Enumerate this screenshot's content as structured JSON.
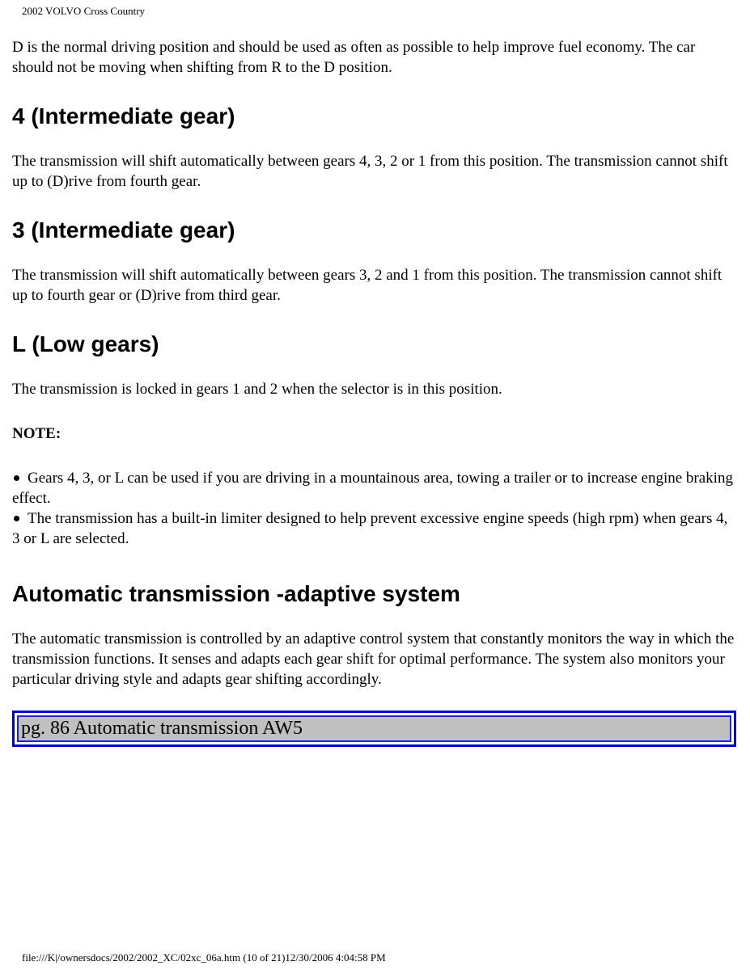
{
  "header": {
    "title": "2002 VOLVO Cross Country"
  },
  "content": {
    "intro": "D is the normal driving position and should be used as often as possible to help improve fuel economy. The car should not be moving when shifting from R to the D position.",
    "sections": [
      {
        "heading": "4 (Intermediate gear)",
        "text": "The transmission will shift automatically between gears 4, 3, 2 or 1 from this position. The transmission cannot shift up to (D)rive from fourth gear."
      },
      {
        "heading": "3 (Intermediate gear)",
        "text": "The transmission will shift automatically between gears 3, 2 and 1 from this position. The transmission cannot shift up to fourth gear or (D)rive from third gear."
      },
      {
        "heading": "L (Low gears)",
        "text": "The transmission is locked in gears 1 and 2 when the selector is in this position."
      }
    ],
    "note_label": "NOTE:",
    "bullets": [
      "Gears 4, 3, or L can be used if you are driving in a mountainous area, towing a trailer or to increase engine braking effect.",
      "The transmission has a built-in limiter designed to help prevent excessive engine speeds (high rpm) when gears 4, 3 or L are selected."
    ],
    "adaptive": {
      "heading": "Automatic transmission -adaptive system",
      "text": "The automatic transmission is controlled by an adaptive control system that constantly monitors the way in which the transmission functions. It senses and adapts each gear shift for optimal performance. The system also monitors your particular driving style and adapts gear shifting accordingly."
    }
  },
  "nav": {
    "link_label": "pg. 86 Automatic transmission AW5"
  },
  "footer": {
    "text": "file:///K|/ownersdocs/2002/2002_XC/02xc_06a.htm (10 of 21)12/30/2006 4:04:58 PM"
  },
  "colors": {
    "nav_border": "#0000cc",
    "nav_fill": "#c0c0c0"
  }
}
